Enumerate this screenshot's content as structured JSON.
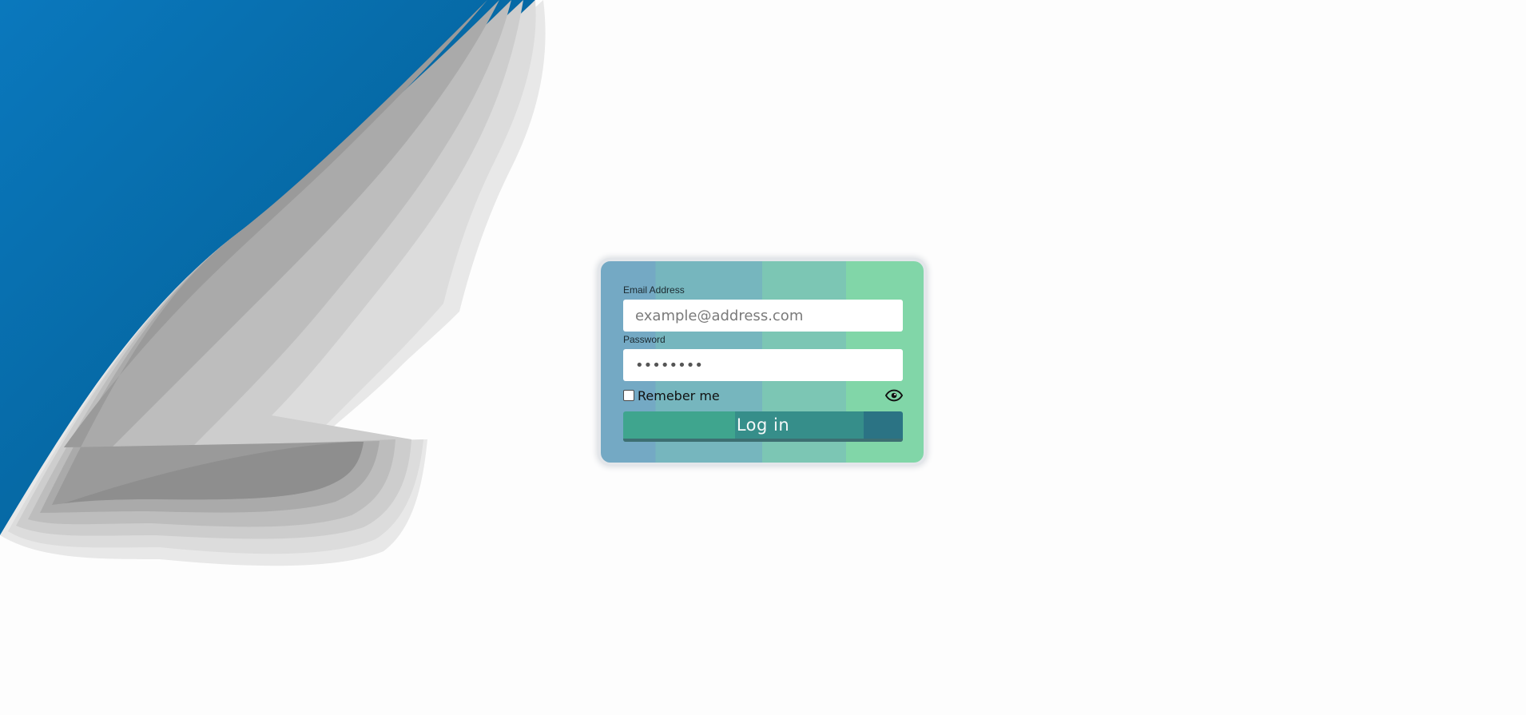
{
  "login": {
    "email_label": "Email Address",
    "email_placeholder": "example@address.com",
    "password_label": "Password",
    "password_value": "********",
    "remember_label": "Remeber me",
    "login_label": "Log in",
    "show_password_icon": "eye-icon"
  },
  "colors": {
    "peel_blue": "#0a75b8",
    "button_teal": "#368e8a",
    "card_green": "#81d6a8"
  }
}
